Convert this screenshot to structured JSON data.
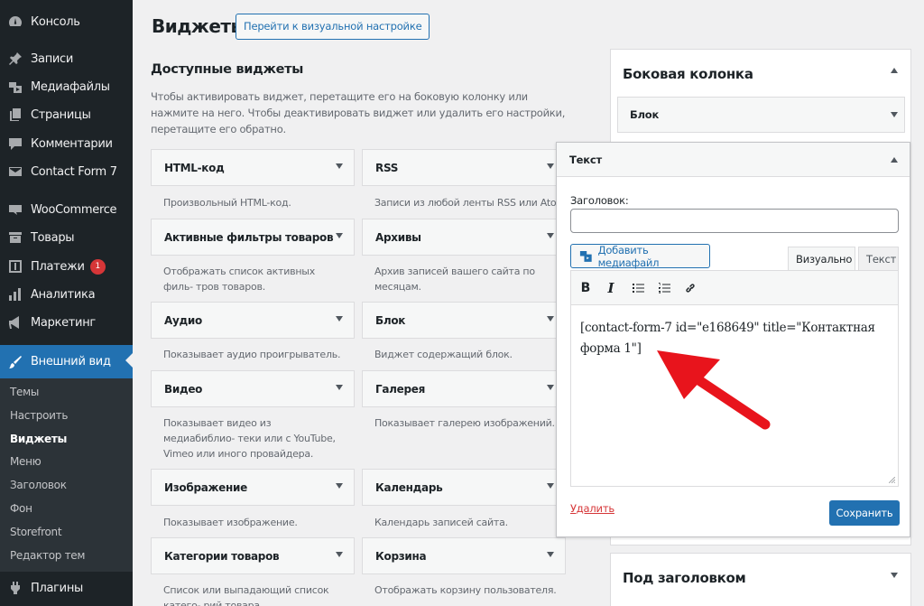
{
  "sidebar": {
    "items": [
      {
        "label": "Консоль",
        "icon": "dashboard-icon"
      },
      {
        "label": "Записи",
        "icon": "pin-icon"
      },
      {
        "label": "Медиафайлы",
        "icon": "media-icon"
      },
      {
        "label": "Страницы",
        "icon": "pages-icon"
      },
      {
        "label": "Комментарии",
        "icon": "comments-icon"
      },
      {
        "label": "Contact Form 7",
        "icon": "mail-icon"
      },
      {
        "label": "WooCommerce",
        "icon": "woo-icon"
      },
      {
        "label": "Товары",
        "icon": "products-icon"
      },
      {
        "label": "Платежи",
        "icon": "payments-icon",
        "badge": "1"
      },
      {
        "label": "Аналитика",
        "icon": "analytics-icon"
      },
      {
        "label": "Маркетинг",
        "icon": "megaphone-icon"
      },
      {
        "label": "Внешний вид",
        "icon": "brush-icon"
      },
      {
        "label": "Плагины",
        "icon": "plugins-icon"
      }
    ],
    "submenu": [
      "Темы",
      "Настроить",
      "Виджеты",
      "Меню",
      "Заголовок",
      "Фон",
      "Storefront",
      "Редактор тем"
    ]
  },
  "header": {
    "title": "Виджеты",
    "customize_button": "Перейти к визуальной настройке"
  },
  "available": {
    "title": "Доступные виджеты",
    "description": "Чтобы активировать виджет, перетащите его на боковую колонку или нажмите на него. Чтобы деактивировать виджет или удалить его настройки, перетащите его обратно.",
    "widgets": [
      {
        "name": "HTML-код",
        "desc": "Произвольный HTML-код."
      },
      {
        "name": "RSS",
        "desc": "Записи из любой ленты RSS или Atom."
      },
      {
        "name": "Активные фильтры товаров",
        "desc": "Отображать список активных филь- тров товаров."
      },
      {
        "name": "Архивы",
        "desc": "Архив записей вашего сайта по месяцам."
      },
      {
        "name": "Аудио",
        "desc": "Показывает аудио проигрыватель."
      },
      {
        "name": "Блок",
        "desc": "Виджет содержащий блок."
      },
      {
        "name": "Видео",
        "desc": "Показывает видео из медиабиблио- теки или с YouTube, Vimeo или иного провайдера."
      },
      {
        "name": "Галерея",
        "desc": "Показывает галерею изображений."
      },
      {
        "name": "Изображение",
        "desc": "Показывает изображение."
      },
      {
        "name": "Календарь",
        "desc": "Календарь записей сайта."
      },
      {
        "name": "Категории товаров",
        "desc": "Список или выпадающий список катего- рий товара."
      },
      {
        "name": "Корзина",
        "desc": "Отображать корзину пользователя."
      }
    ]
  },
  "sidebar_area": {
    "title": "Боковая колонка",
    "block_widget": "Блок",
    "below_header": "Под заголовком"
  },
  "text_widget": {
    "title": "Текст",
    "heading_label": "Заголовок:",
    "heading_value": "",
    "add_media": "Добавить медиафайл",
    "tab_visual": "Визуально",
    "tab_text": "Текст",
    "content": "[contact-form-7 id=\"e168649\" title=\"Контактная форма 1\"]",
    "delete": "Удалить",
    "save": "Сохранить"
  },
  "colors": {
    "accent": "#2271b1",
    "sidebar_bg": "#1d2327",
    "arrow": "#e8141c"
  }
}
